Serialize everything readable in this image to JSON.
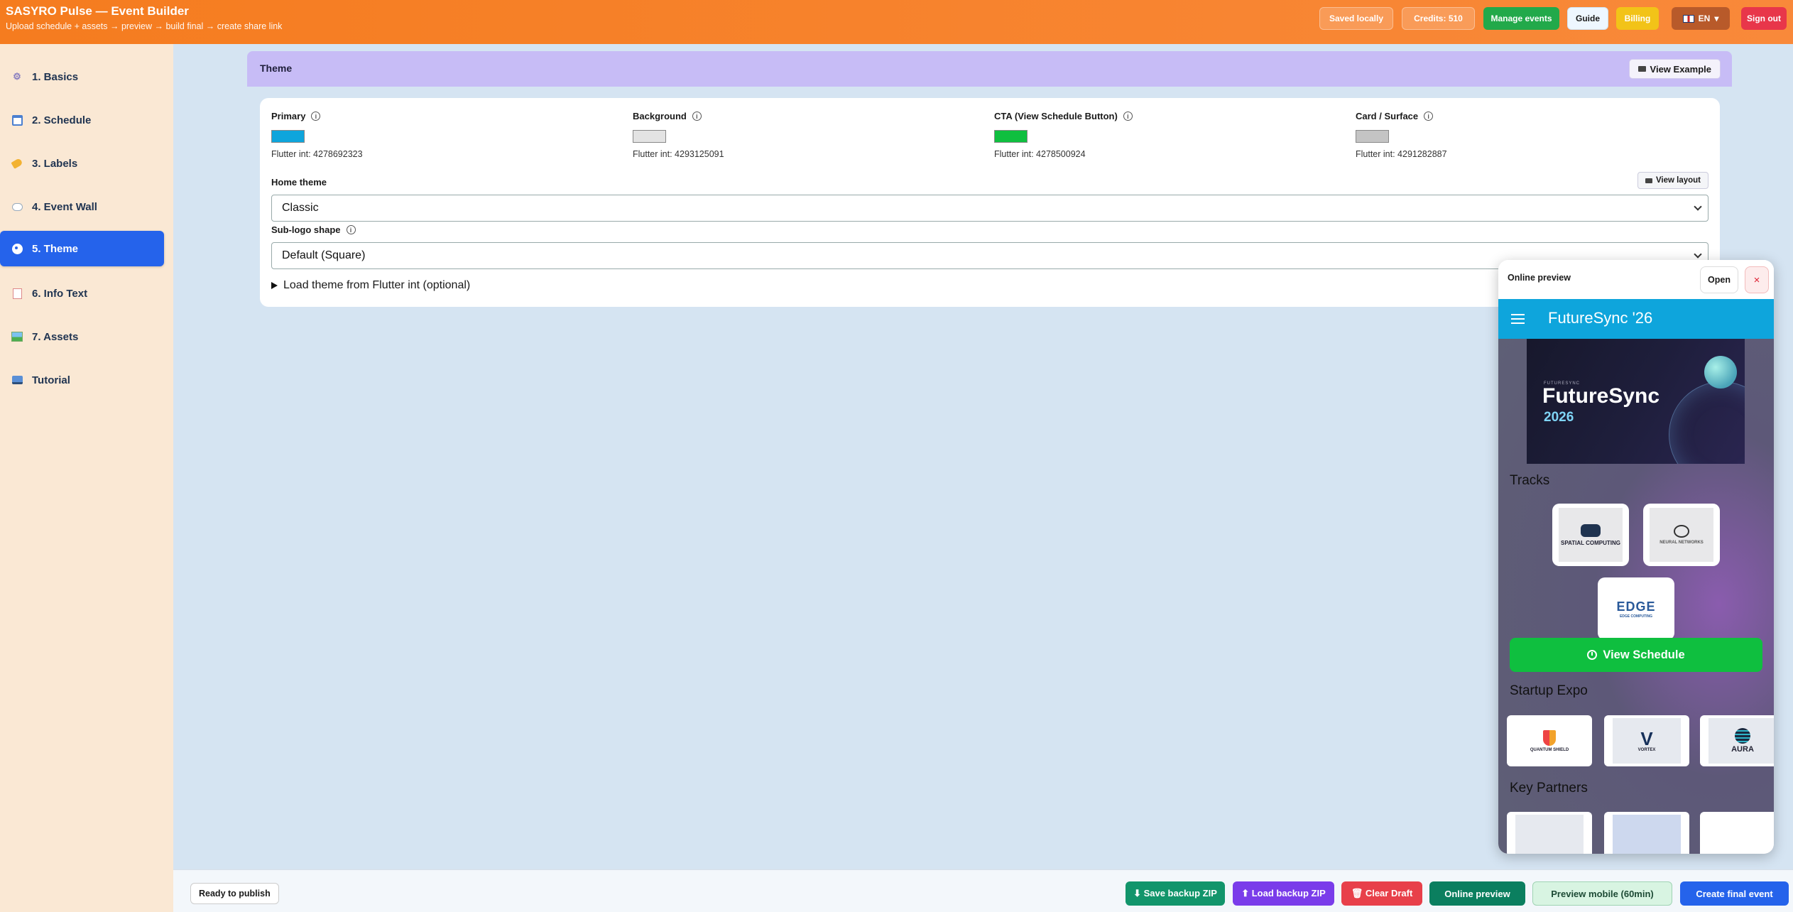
{
  "header": {
    "title": "SASYRO Pulse — Event Builder",
    "subtitle": "Upload schedule + assets → preview → build final → create share link",
    "saved_label": "Saved locally",
    "credits_label": "Credits: 510",
    "manage_label": "Manage events",
    "guide_label": "Guide",
    "billing_label": "Billing",
    "lang_label": "EN",
    "signout_label": "Sign out"
  },
  "sidebar": {
    "items": [
      {
        "label": "1. Basics",
        "icon": "gear-icon"
      },
      {
        "label": "2. Schedule",
        "icon": "calendar-icon"
      },
      {
        "label": "3. Labels",
        "icon": "tag-icon"
      },
      {
        "label": "4. Event Wall",
        "icon": "speech-bubble-icon"
      },
      {
        "label": "5. Theme",
        "icon": "palette-icon",
        "active": true
      },
      {
        "label": "6. Info Text",
        "icon": "memo-icon"
      },
      {
        "label": "7. Assets",
        "icon": "picture-icon"
      },
      {
        "label": "Tutorial",
        "icon": "tutorial-icon"
      }
    ]
  },
  "theme": {
    "section_title": "Theme",
    "view_example_label": "View Example",
    "colors": [
      {
        "label": "Primary",
        "hex": "#0ea5dc",
        "flutter_text": "Flutter int: 4278692323"
      },
      {
        "label": "Background",
        "hex": "#e3e3e3",
        "flutter_text": "Flutter int: 4293125091"
      },
      {
        "label": "CTA (View Schedule Button)",
        "hex": "#0fbf3f",
        "flutter_text": "Flutter int: 4278500924"
      },
      {
        "label": "Card / Surface",
        "hex": "#c4c4c4",
        "flutter_text": "Flutter int: 4291282887"
      }
    ],
    "home_theme_label": "Home theme",
    "view_layout_label": "View layout",
    "home_theme_value": "Classic",
    "sublogo_label": "Sub-logo shape",
    "sublogo_value": "Default (Square)",
    "load_theme_label": "Load theme from Flutter int (optional)"
  },
  "preview": {
    "title": "Online preview",
    "open_label": "Open",
    "close_label": "×",
    "app_name": "FutureSync '26",
    "banner_small": "FUTURESYNC",
    "banner_title": "FutureSync",
    "banner_year": "2026",
    "tracks_label": "Tracks",
    "tracks": [
      "SPATIAL COMPUTING",
      "NEURAL NETWORKS",
      "EDGE COMPUTING"
    ],
    "schedule_label": "View Schedule",
    "startup_label": "Startup Expo",
    "startups": [
      "QUANTUM SHIELD",
      "VORTEX",
      "AURA"
    ],
    "partners_label": "Key Partners"
  },
  "footer": {
    "status_label": "Ready to publish",
    "save_backup_label": "⬇ Save backup ZIP",
    "load_backup_label": "⬆ Load backup ZIP",
    "clear_draft_label": "🗑 Clear Draft",
    "online_preview_label": "Online preview",
    "preview_mobile_label": "Preview mobile (60min)",
    "create_final_label": "Create final event"
  }
}
